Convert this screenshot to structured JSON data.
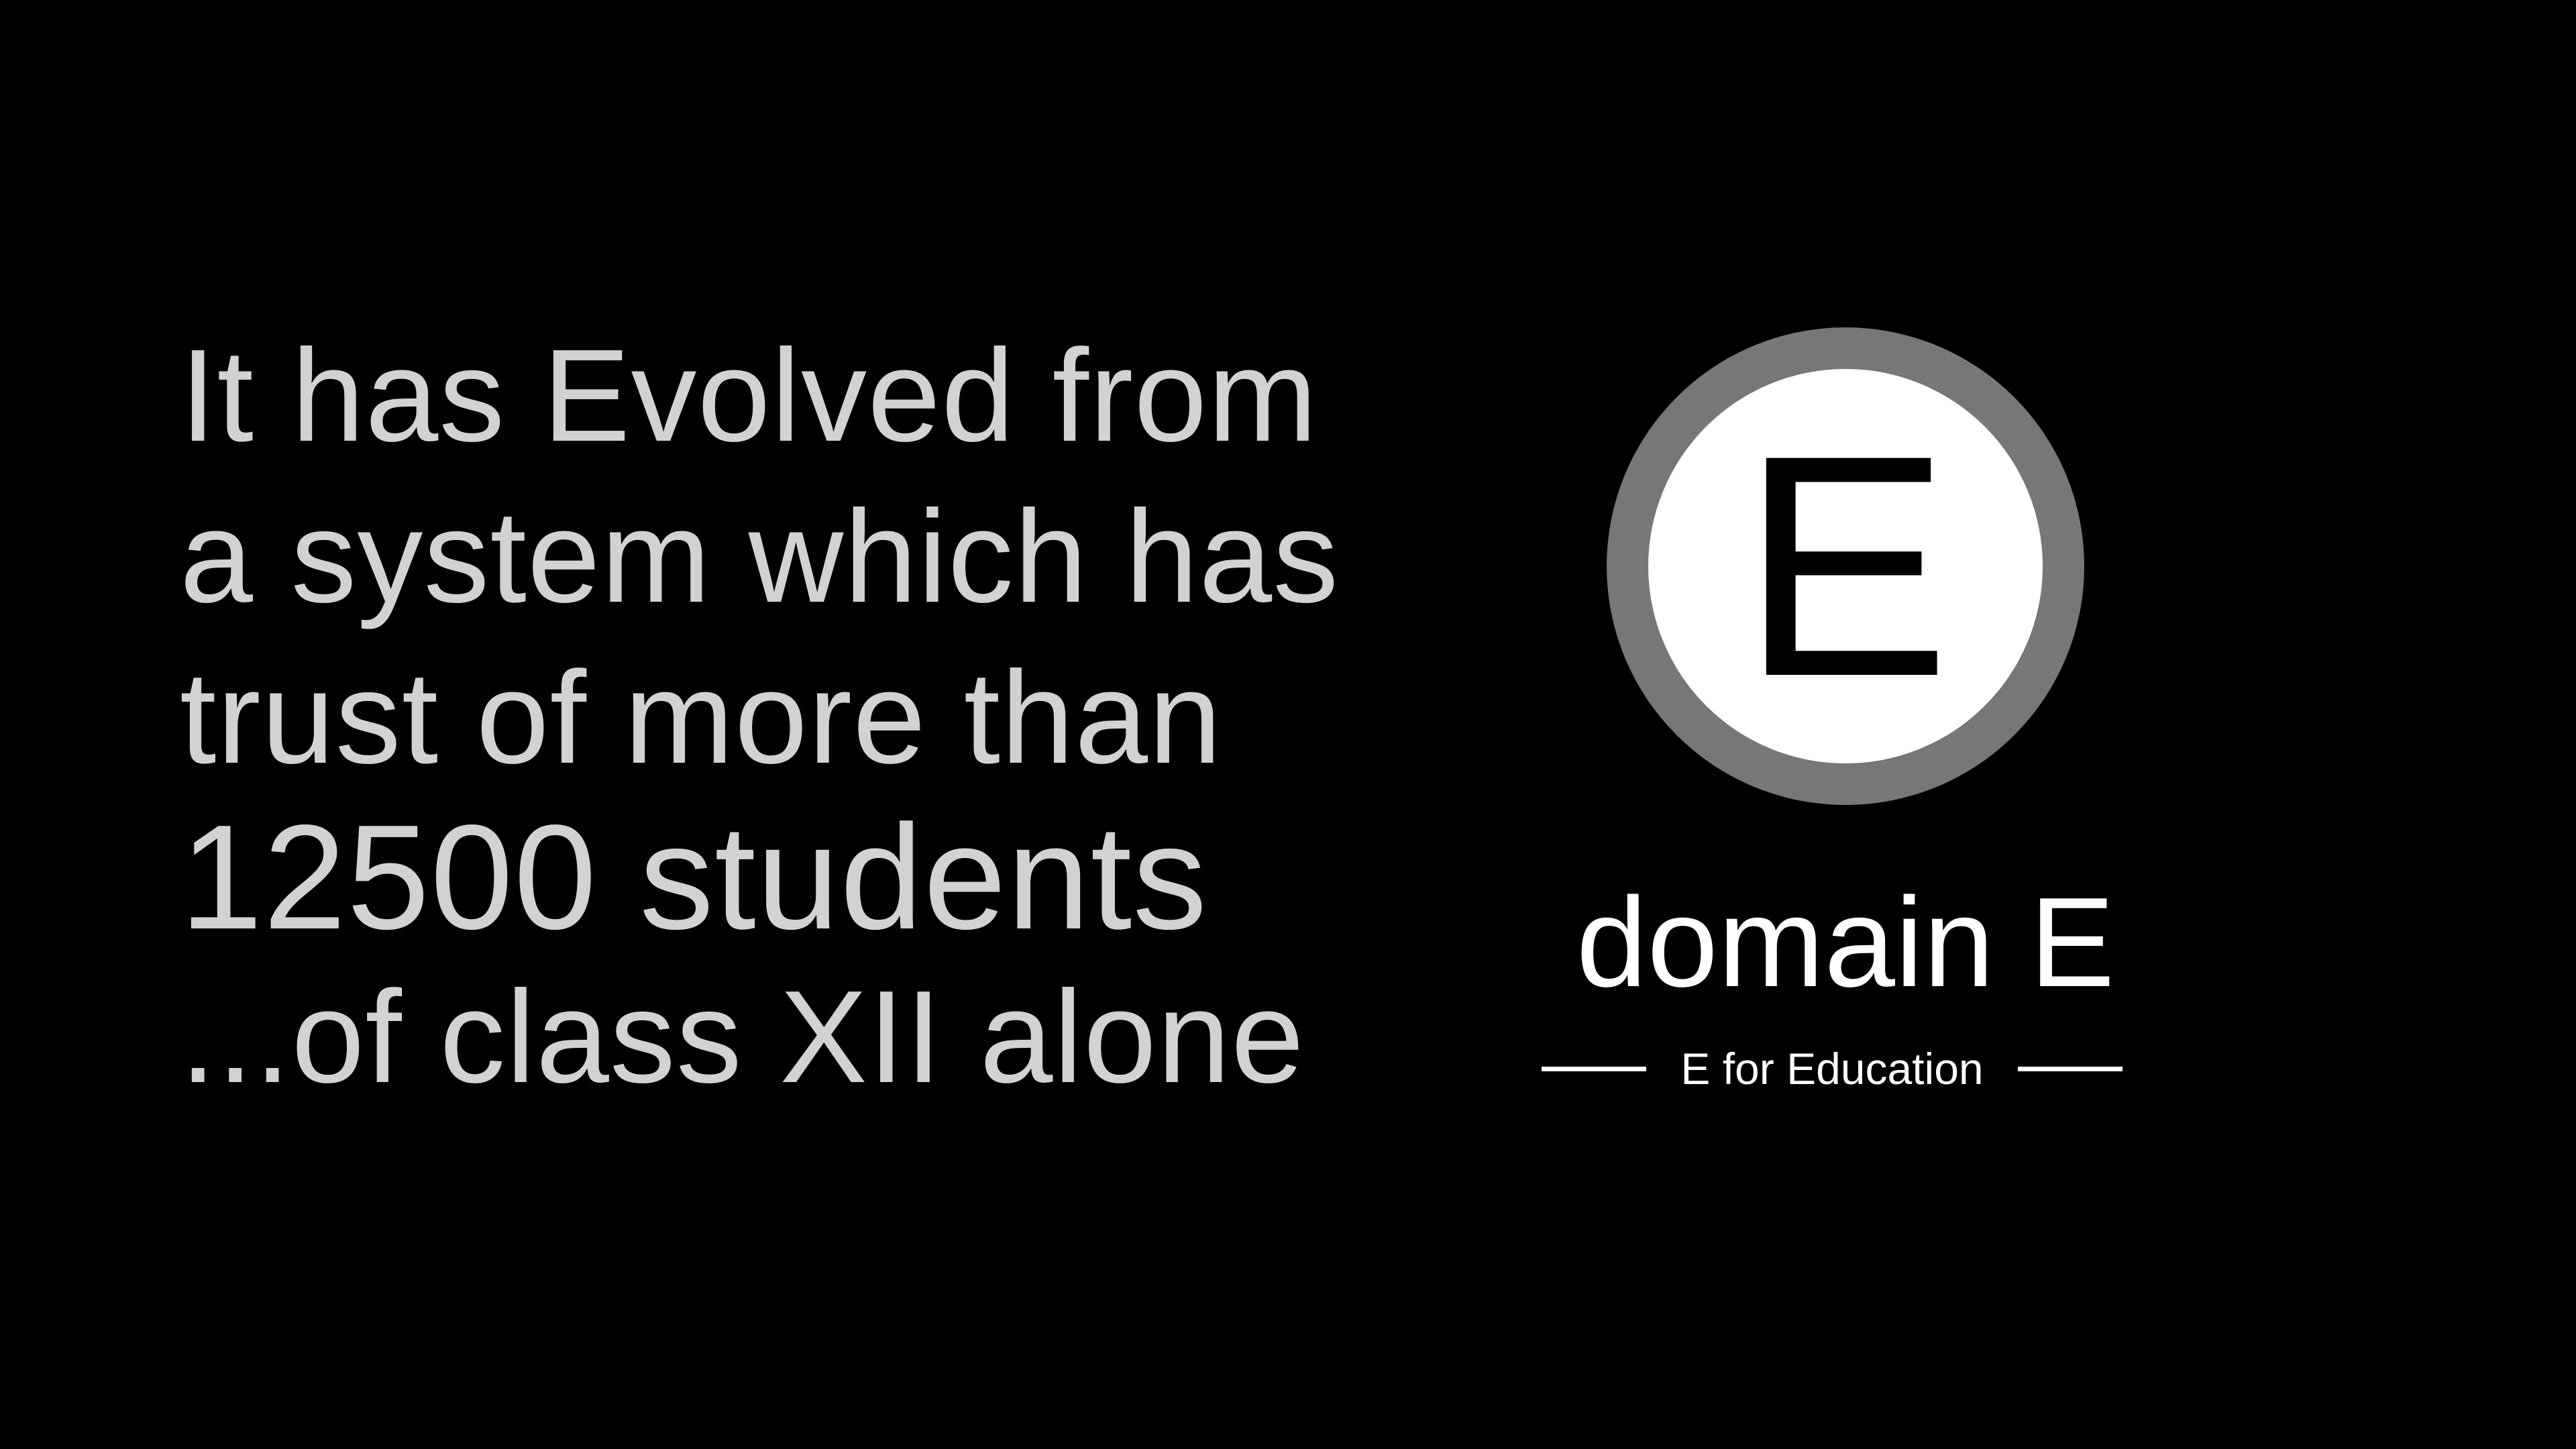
{
  "headline": {
    "lines": [
      "It has Evolved from",
      "a system which has",
      "trust of more than",
      "12500 students",
      "...of class XII alone"
    ]
  },
  "logo": {
    "letter": "E",
    "ring_color": "#777777",
    "fill_color": "#ffffff",
    "letter_color": "#000000"
  },
  "brand": {
    "name": "domain E",
    "tagline": "E for Education"
  },
  "colors": {
    "background": "#000000",
    "headline_text": "#d2d2d2",
    "brand_text": "#ffffff"
  }
}
